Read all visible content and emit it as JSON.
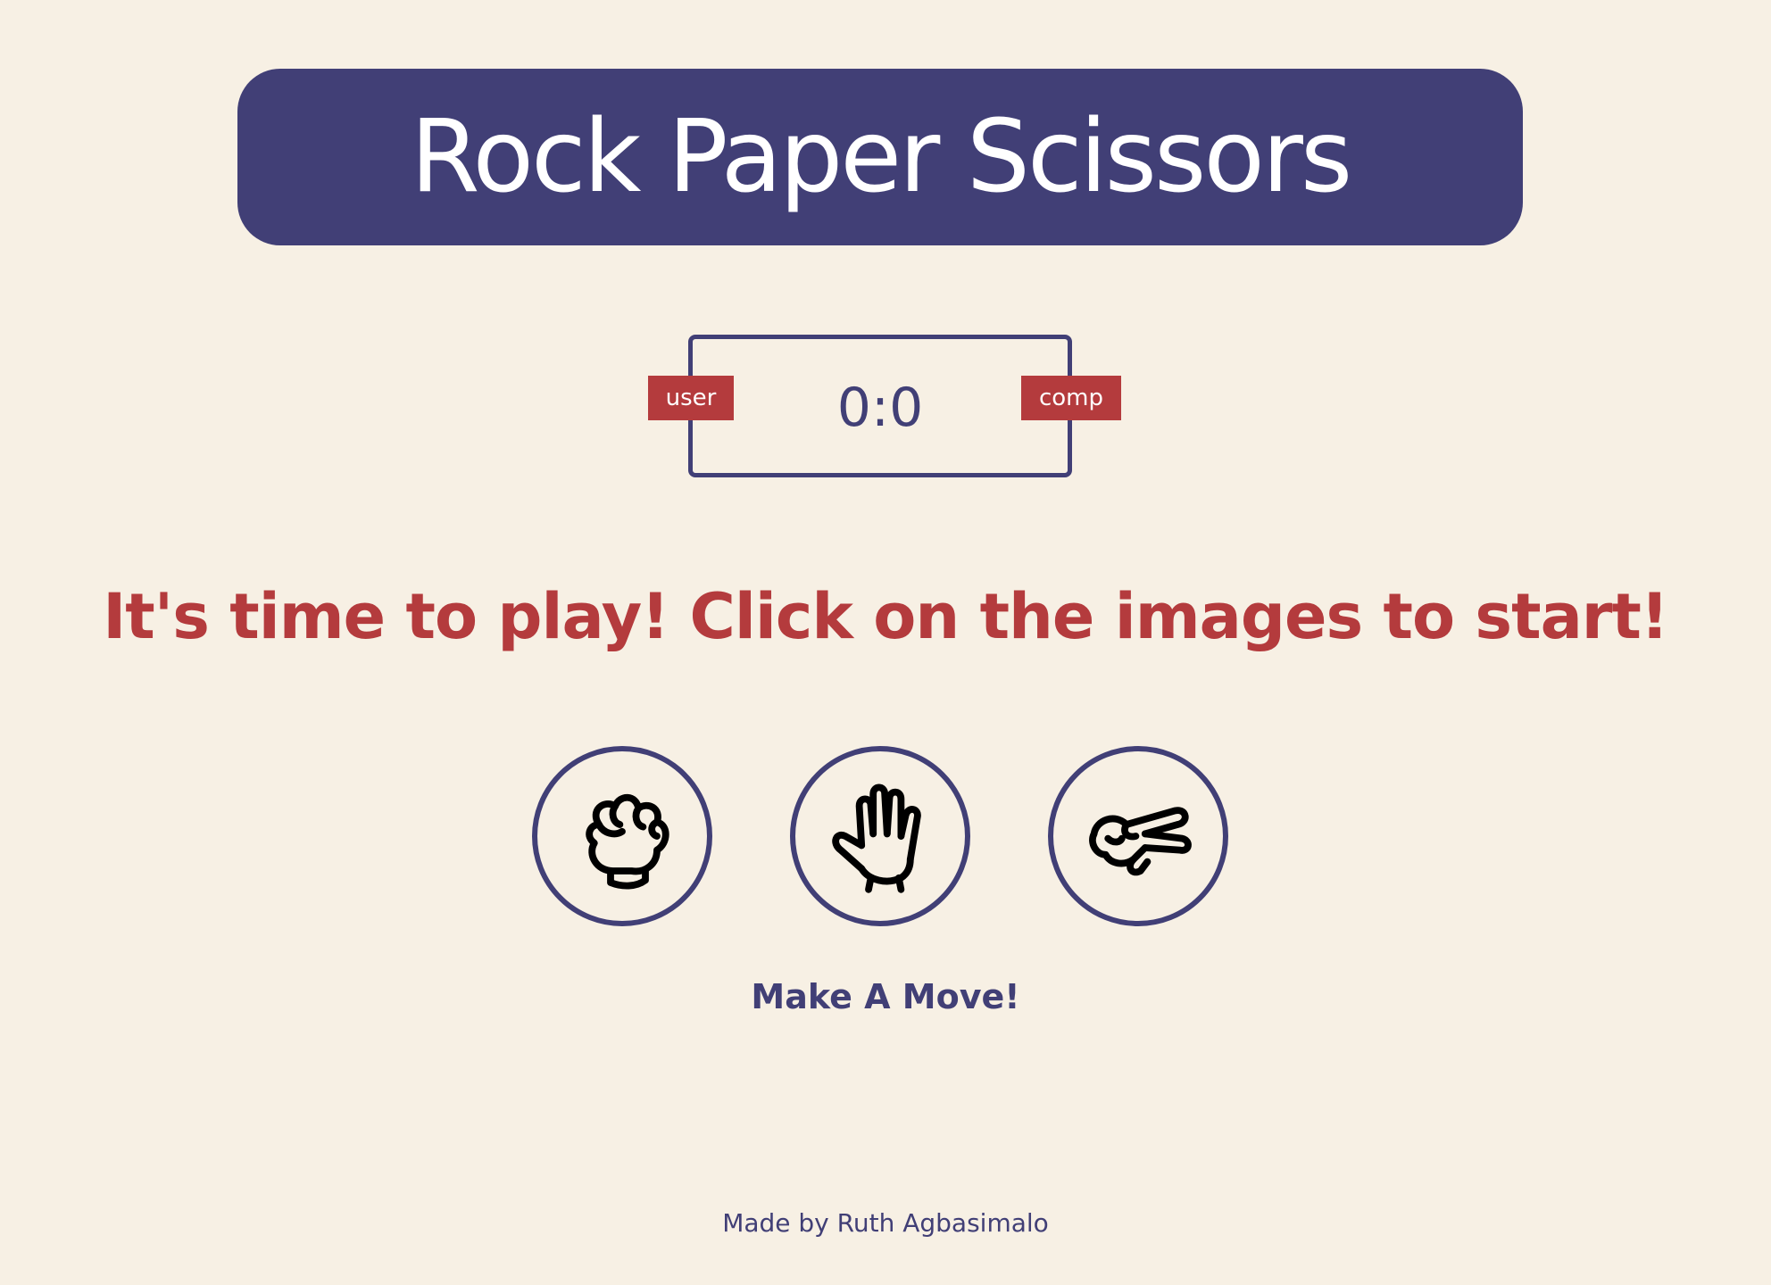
{
  "header": {
    "title": "Rock Paper Scissors"
  },
  "scoreboard": {
    "user_label": "user",
    "comp_label": "comp",
    "score": "0:0"
  },
  "message": "It's time to play! Click on the images to start!",
  "choices": [
    {
      "name": "rock",
      "icon": "rock-hand-icon"
    },
    {
      "name": "paper",
      "icon": "paper-hand-icon"
    },
    {
      "name": "scissors",
      "icon": "scissors-hand-icon"
    }
  ],
  "prompt": "Make A Move!",
  "footer": "Made by Ruth Agbasimalo",
  "colors": {
    "background": "#f7f0e4",
    "primary": "#413f76",
    "accent": "#b43b3d"
  }
}
